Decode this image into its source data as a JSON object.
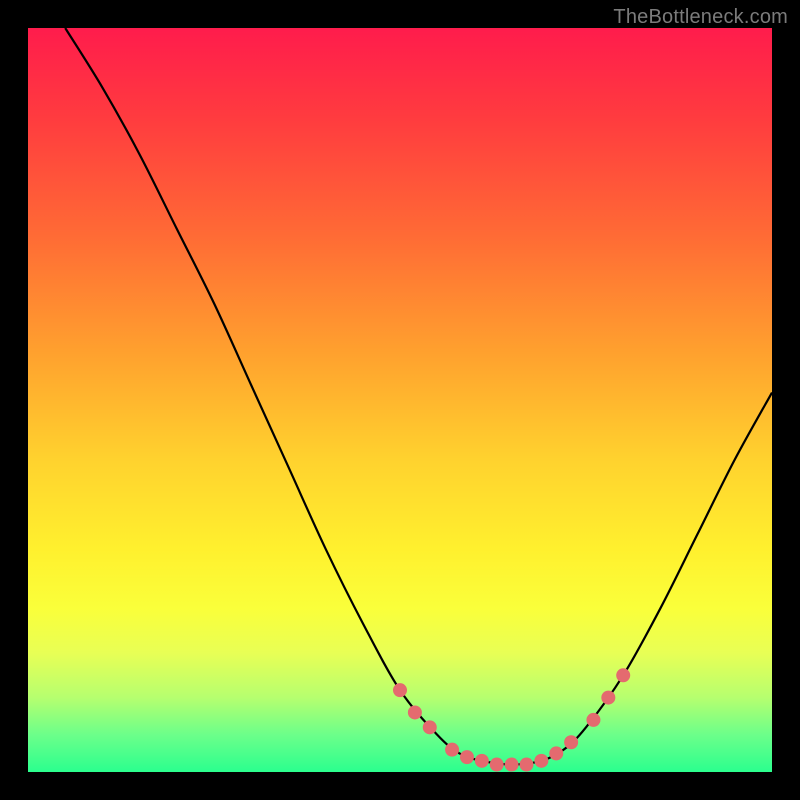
{
  "watermark": "TheBottleneck.com",
  "chart_data": {
    "type": "line",
    "title": "",
    "xlabel": "",
    "ylabel": "",
    "xlim": [
      0,
      100
    ],
    "ylim": [
      0,
      100
    ],
    "grid": false,
    "legend": false,
    "gradient_stops": [
      {
        "pos": 0,
        "color": "#ff1c4c"
      },
      {
        "pos": 12,
        "color": "#ff3b3f"
      },
      {
        "pos": 28,
        "color": "#ff6b35"
      },
      {
        "pos": 44,
        "color": "#ffa22e"
      },
      {
        "pos": 58,
        "color": "#ffd22e"
      },
      {
        "pos": 70,
        "color": "#fff02e"
      },
      {
        "pos": 78,
        "color": "#faff3a"
      },
      {
        "pos": 84,
        "color": "#e8ff55"
      },
      {
        "pos": 90,
        "color": "#b6ff6f"
      },
      {
        "pos": 95,
        "color": "#6cff8a"
      },
      {
        "pos": 100,
        "color": "#2bff8e"
      }
    ],
    "series": [
      {
        "name": "bottleneck-curve",
        "note": "values are approximate, read visually; y=0 bottom, y=100 top",
        "points": [
          {
            "x": 5,
            "y": 100
          },
          {
            "x": 10,
            "y": 92
          },
          {
            "x": 15,
            "y": 83
          },
          {
            "x": 20,
            "y": 73
          },
          {
            "x": 25,
            "y": 63
          },
          {
            "x": 30,
            "y": 52
          },
          {
            "x": 35,
            "y": 41
          },
          {
            "x": 40,
            "y": 30
          },
          {
            "x": 45,
            "y": 20
          },
          {
            "x": 50,
            "y": 11
          },
          {
            "x": 55,
            "y": 5
          },
          {
            "x": 58,
            "y": 2.5
          },
          {
            "x": 61,
            "y": 1.5
          },
          {
            "x": 65,
            "y": 1
          },
          {
            "x": 69,
            "y": 1.5
          },
          {
            "x": 72,
            "y": 3
          },
          {
            "x": 75,
            "y": 6
          },
          {
            "x": 80,
            "y": 13
          },
          {
            "x": 85,
            "y": 22
          },
          {
            "x": 90,
            "y": 32
          },
          {
            "x": 95,
            "y": 42
          },
          {
            "x": 100,
            "y": 51
          }
        ]
      }
    ],
    "highlight_points": {
      "name": "highlighted-data-points",
      "color": "#e46a6f",
      "radius_px": 7,
      "points": [
        {
          "x": 50,
          "y": 11
        },
        {
          "x": 52,
          "y": 8
        },
        {
          "x": 54,
          "y": 6
        },
        {
          "x": 57,
          "y": 3
        },
        {
          "x": 59,
          "y": 2
        },
        {
          "x": 61,
          "y": 1.5
        },
        {
          "x": 63,
          "y": 1
        },
        {
          "x": 65,
          "y": 1
        },
        {
          "x": 67,
          "y": 1
        },
        {
          "x": 69,
          "y": 1.5
        },
        {
          "x": 71,
          "y": 2.5
        },
        {
          "x": 73,
          "y": 4
        },
        {
          "x": 76,
          "y": 7
        },
        {
          "x": 78,
          "y": 10
        },
        {
          "x": 80,
          "y": 13
        }
      ]
    }
  }
}
